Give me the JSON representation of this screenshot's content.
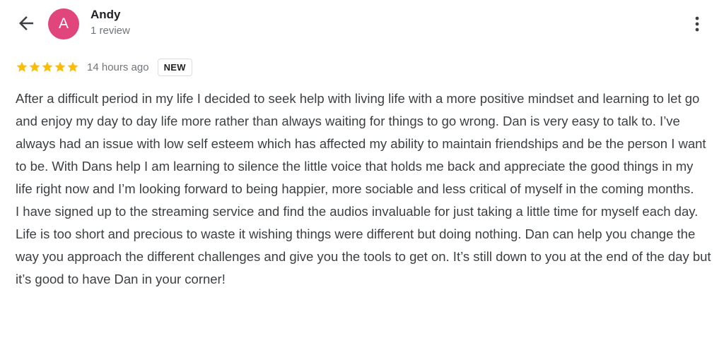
{
  "header": {
    "back_icon": "arrow-left-icon",
    "avatar_initial": "A",
    "avatar_color": "#e0457b",
    "reviewer_name": "Andy",
    "review_count": "1 review",
    "more_icon": "more-vert-icon"
  },
  "rating": {
    "stars": 5,
    "max_stars": 5,
    "star_color": "#fbbc04",
    "time_ago": "14 hours ago",
    "badge": "NEW"
  },
  "review": {
    "paragraphs": [
      "After a difficult period in my life I decided to seek help with living life with a more positive mindset and learning to let go and enjoy my day to day life more rather than always waiting for things to go wrong. Dan is very easy to talk to. I’ve always had an issue with low self esteem which has affected my ability to maintain friendships and be the person I want to be. With Dans help I am learning to silence the little voice that holds me back and appreciate the good things in my life right now and I’m looking forward to being happier, more sociable and less critical of myself in the coming months.",
      "I have signed up to the streaming service and find the audios invaluable for just taking a little time for myself each day.",
      "Life is too short and precious to waste it wishing things were different but doing nothing. Dan can help you change the way you approach the different challenges and give you the tools to get on. It’s still down to you at the end of the day but it’s good to have Dan in your corner!"
    ]
  }
}
